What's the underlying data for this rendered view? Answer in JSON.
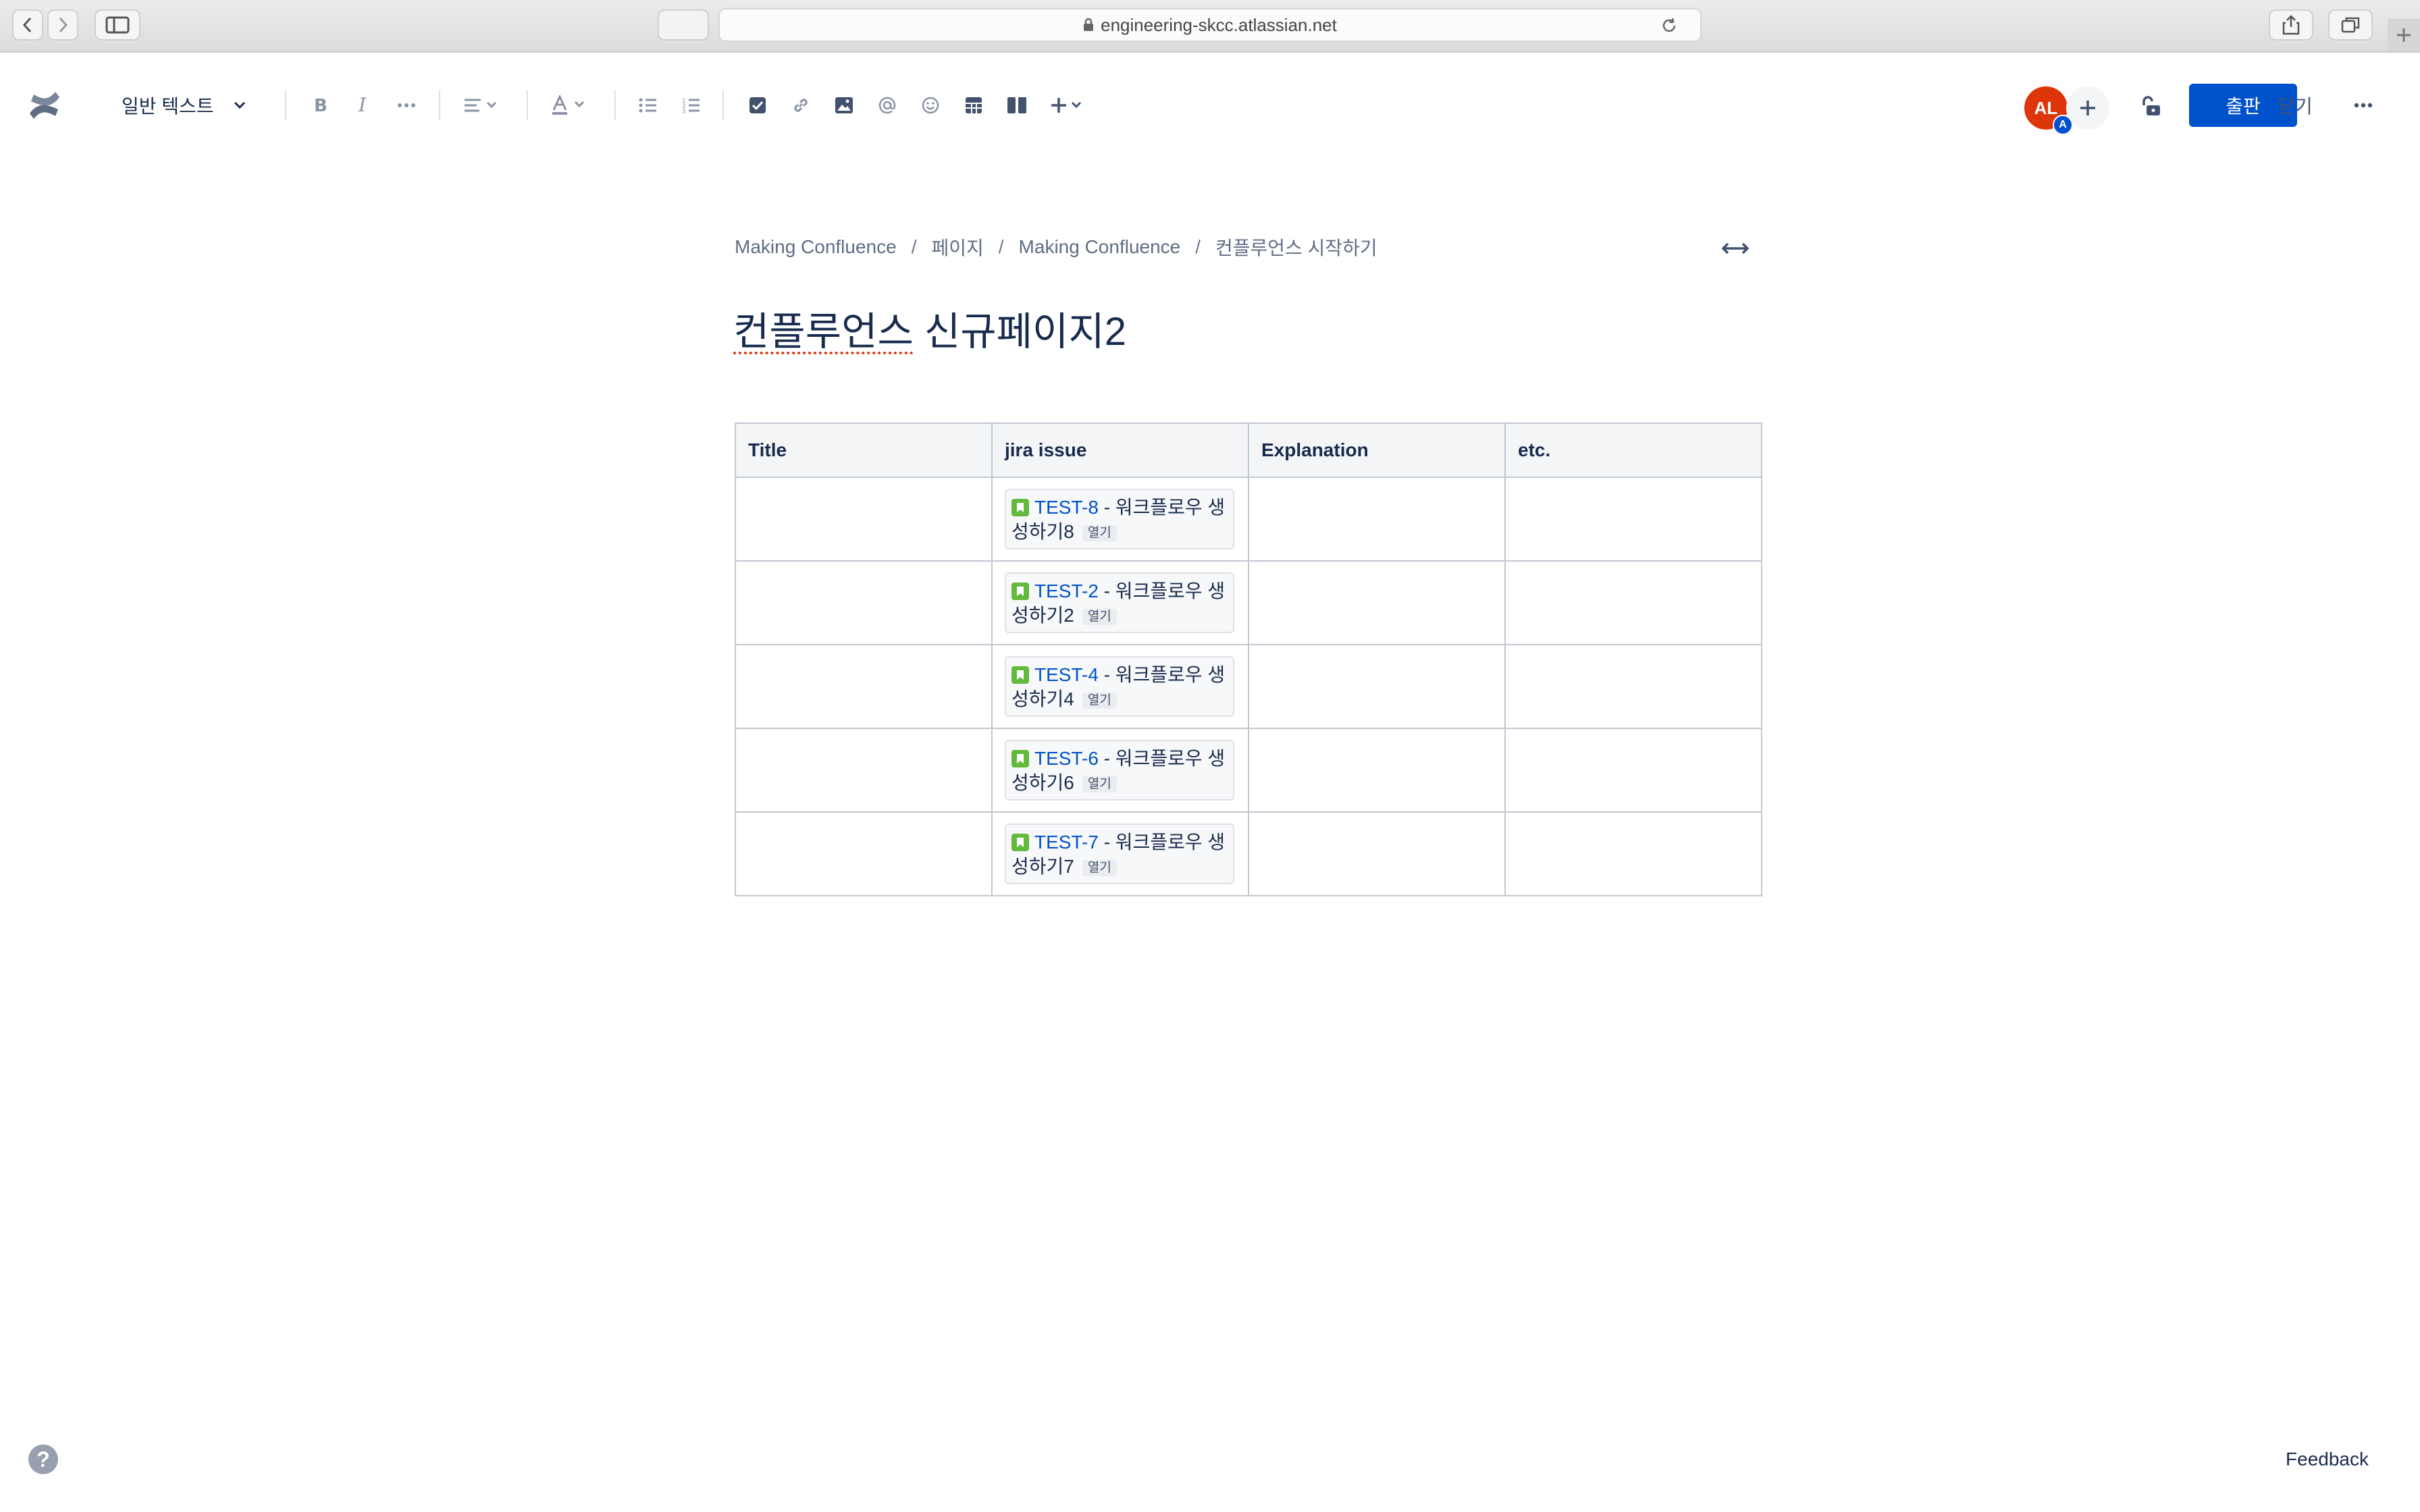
{
  "browser": {
    "url": "engineering-skcc.atlassian.net"
  },
  "toolbar": {
    "text_style": "일반 텍스트",
    "avatar_initials": "AL",
    "avatar_badge": "A",
    "publish_label": "출판",
    "close_label": "닫기"
  },
  "breadcrumb": {
    "items": [
      "Making Confluence",
      "페이지",
      "Making Confluence",
      "컨플루언스 시작하기"
    ],
    "separator": "/"
  },
  "page": {
    "title_part1": "컨플루언스",
    "title_part2": " 신규페이지2"
  },
  "table": {
    "headers": [
      "Title",
      "jira issue",
      "Explanation",
      "etc."
    ],
    "rows": [
      {
        "key": "TEST-8",
        "summary": " - 워크플로우 생성하기8",
        "open": "열기"
      },
      {
        "key": "TEST-2",
        "summary": " - 워크플로우 생성하기2",
        "open": "열기"
      },
      {
        "key": "TEST-4",
        "summary": " - 워크플로우 생성하기4",
        "open": "열기"
      },
      {
        "key": "TEST-6",
        "summary": " - 워크플로우 생성하기6",
        "open": "열기"
      },
      {
        "key": "TEST-7",
        "summary": " - 워크플로우 생성하기7",
        "open": "열기"
      }
    ]
  },
  "footer": {
    "help": "?",
    "feedback": "Feedback"
  },
  "colors": {
    "primary": "#0052cc",
    "avatar": "#de350b",
    "jira_story": "#63ba3c",
    "text": "#172b4d"
  }
}
